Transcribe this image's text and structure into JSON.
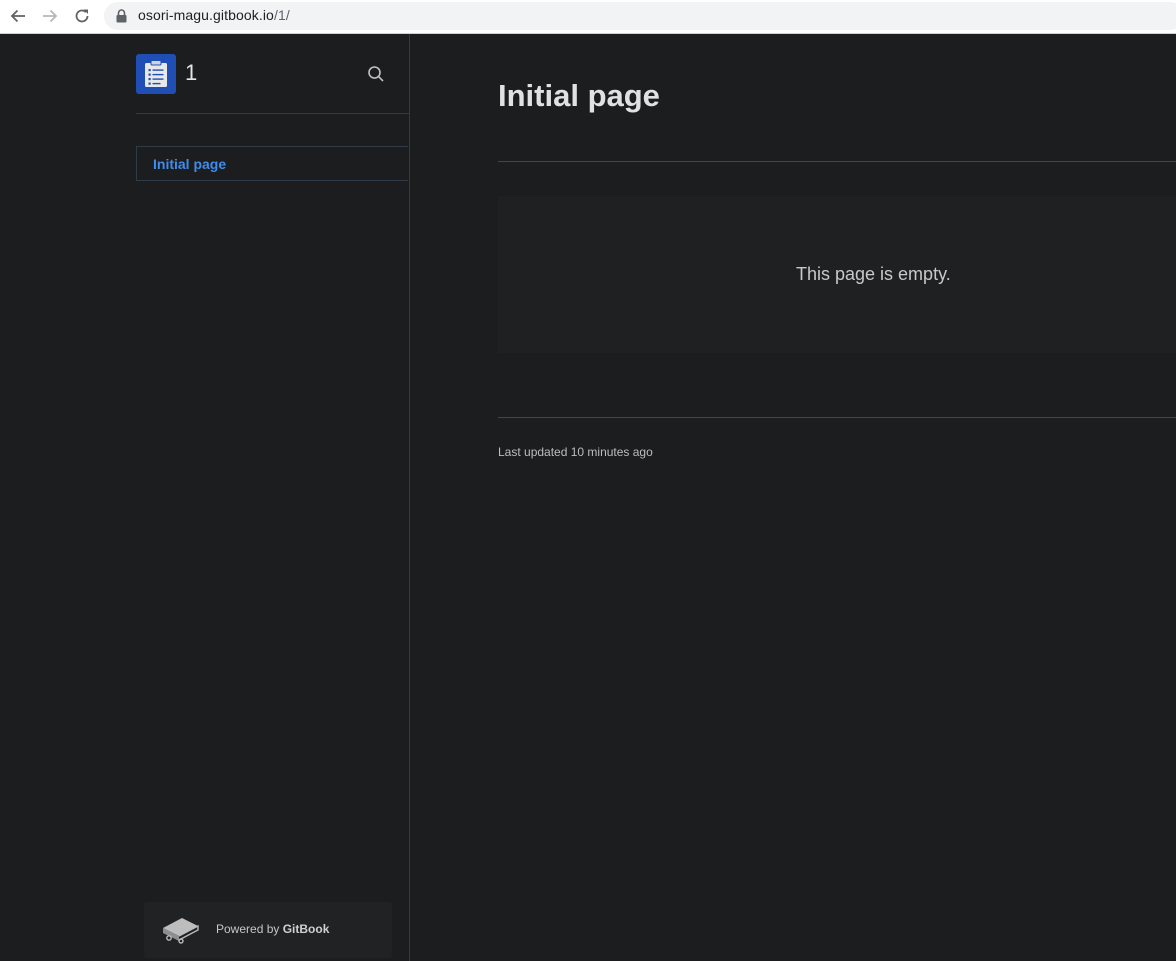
{
  "browser": {
    "url_host": "osori-magu.gitbook.io",
    "url_path": "/1/"
  },
  "sidebar": {
    "space_title": "1",
    "nav_items": [
      {
        "label": "Initial page",
        "active": true
      }
    ],
    "powered_by": {
      "prefix": "Powered by ",
      "brand": "GitBook"
    }
  },
  "main": {
    "page_title": "Initial page",
    "empty_message": "This page is empty.",
    "last_updated": "Last updated 10 minutes ago"
  },
  "colors": {
    "background": "#1c1d1f",
    "accent": "#3d8cf0",
    "logo_bg": "#1f4fb4",
    "divider": "#2f3b46"
  },
  "icons": [
    "back-arrow-icon",
    "forward-arrow-icon",
    "reload-icon",
    "lock-icon",
    "notepad-logo-icon",
    "search-icon",
    "gitbook-icon"
  ]
}
